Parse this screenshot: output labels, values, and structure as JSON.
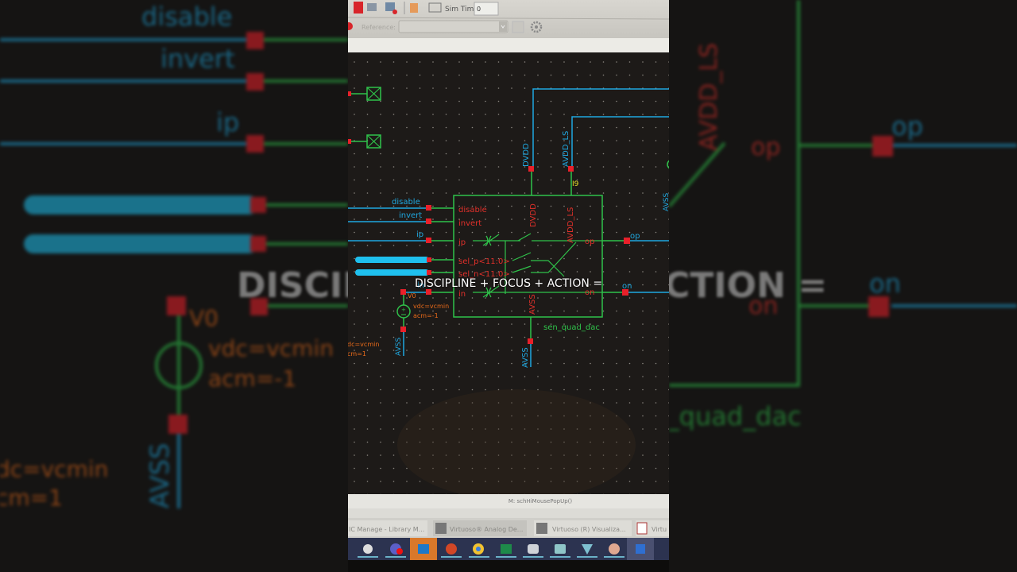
{
  "toolbar": {
    "sim_time_label": "Sim Time",
    "sim_time_value": "0",
    "reference_label": "Reference:",
    "reference_value": ""
  },
  "schematic": {
    "instance_name": "sen_quad_dac",
    "instance_id": "I9",
    "supply_nets": {
      "dvdd": "DVDD",
      "avdd_ls": "AVDD_LS",
      "avss": "AVSS"
    },
    "left_nets": {
      "disable": "disable",
      "invert": "invert",
      "ip": "ip",
      "in": "in"
    },
    "pins": {
      "disable": "disable",
      "invert": "invert",
      "ip": "ip",
      "sel_p": "sel_p<11:0>",
      "sel_n": "sel_n<11:0>",
      "in": "in",
      "op": "op",
      "on": "on",
      "dvdd": "DVDD",
      "avdd_ls": "AVDD_LS",
      "avss": "AVSS"
    },
    "right_nets": {
      "op": "op",
      "on": "on"
    },
    "source": {
      "name": "V0",
      "vdc": "vdc=vcmin",
      "acm": "acm=-1"
    },
    "source2": {
      "vdc": "dc=vcmin",
      "acm": "cm=1"
    }
  },
  "status_bar": {
    "message": "M: schHiMousePopUp()"
  },
  "window_tabs": [
    "IC Manage - Library M...",
    "Virtuoso® Analog De...",
    "Virtuoso (R) Visualiza...",
    "Virtu"
  ],
  "taskbar_icons": [
    "settings-icon",
    "teams-icon",
    "outlook-icon",
    "powerpoint-icon",
    "chrome-icon",
    "excel-icon",
    "app-icon",
    "app-icon",
    "vpn-icon",
    "paint-icon",
    "remote-desktop-icon"
  ],
  "caption": {
    "text": "DISCIPLINE + FOCUS + ACTION =",
    "left_fragment": "DISCIP",
    "right_fragment": "CTION ="
  },
  "colors": {
    "wire": "#1fa8e0",
    "net_green": "#2fc24a",
    "pin_red": "#e8202a",
    "label_red": "#e0302a",
    "prop_orange": "#e86a1a",
    "canvas": "#1d1a18"
  }
}
